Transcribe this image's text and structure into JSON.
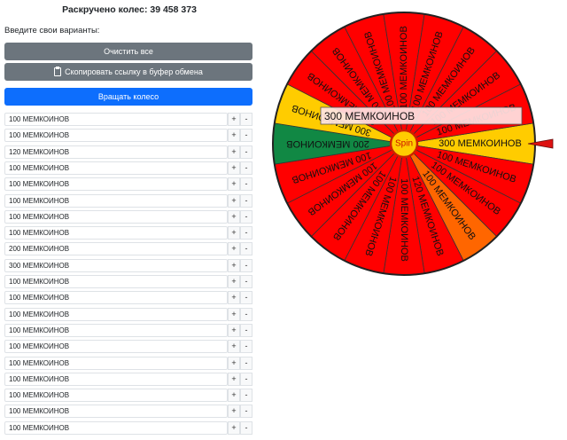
{
  "header": {
    "spin_counter": "Раскручено колес: 39 458 373"
  },
  "form": {
    "hint": "Введите свои варианты:",
    "clear_label": "Очистить все",
    "copy_label": "Скопировать ссылку в буфер обмена",
    "spin_label": "Вращать колесо",
    "plus_label": "+",
    "minus_label": "-"
  },
  "options": [
    "100 МЕМКОИНОВ",
    "100 МЕМКОИНОВ",
    "120 МЕМКОИНОВ",
    "100 МЕМКОИНОВ",
    "100 МЕМКОИНОВ",
    "100 МЕМКОИНОВ",
    "100 МЕМКОИНОВ",
    "100 МЕМКОИНОВ",
    "200 МЕМКОИНОВ",
    "300 МЕМКОИНОВ",
    "100 МЕМКОИНОВ",
    "100 МЕМКОИНОВ",
    "100 МЕМКОИНОВ",
    "100 МЕМКОИНОВ",
    "100 МЕМКОИНОВ",
    "100 МЕМКОИНОВ",
    "100 МЕМКОИНОВ",
    "100 МЕМКОИНОВ",
    "100 МЕМКОИНОВ",
    "100 МЕМКОИНОВ"
  ],
  "wheel": {
    "center_label": "Spin",
    "result_label": "300 МЕМКОИНОВ",
    "colors": {
      "main": "#ff0000",
      "yellow": "#ffcc00",
      "green": "#118844",
      "orange": "#ff6600",
      "hub": "#ffcc00",
      "pointer": "#dd1111",
      "result_bg": "#ffe4e4"
    },
    "segments": [
      {
        "label": "300 МЕМКОИНОВ",
        "color": "yellow"
      },
      {
        "label": "100 МЕМКОИНОВ",
        "color": "main"
      },
      {
        "label": "100 МЕМКОИНОВ",
        "color": "main"
      },
      {
        "label": "100 МЕМКОИНОВ",
        "color": "orange"
      },
      {
        "label": "120 МЕМКОИНОВ",
        "color": "main"
      },
      {
        "label": "100 МЕМКОИНОВ",
        "color": "main"
      },
      {
        "label": "100 МЕМКОИНОВ",
        "color": "main"
      },
      {
        "label": "100 МЕМКОИНОВ",
        "color": "main"
      },
      {
        "label": "100 МЕМКОИНОВ",
        "color": "main"
      },
      {
        "label": "100 МЕМКОИНОВ",
        "color": "main"
      },
      {
        "label": "200 МЕМКОИНОВ",
        "color": "green"
      },
      {
        "label": "300 МЕМКОИНОВ",
        "color": "yellow"
      },
      {
        "label": "100 МЕМКОИНОВ",
        "color": "main"
      },
      {
        "label": "100 МЕМКОИНОВ",
        "color": "main"
      },
      {
        "label": "100 МЕМКОИНОВ",
        "color": "main"
      },
      {
        "label": "100 МЕМКОИНОВ",
        "color": "main"
      },
      {
        "label": "100 МЕМКОИНОВ",
        "color": "main"
      },
      {
        "label": "100 МЕМКОИНОВ",
        "color": "main"
      },
      {
        "label": "100 МЕМКОИНОВ",
        "color": "main"
      },
      {
        "label": "100 МЕМКОИНОВ",
        "color": "main"
      }
    ]
  }
}
